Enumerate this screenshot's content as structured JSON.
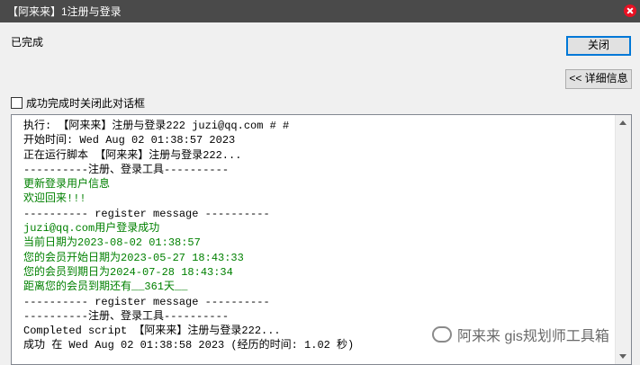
{
  "window": {
    "title": "【阿来来】1注册与登录"
  },
  "status_text": "已完成",
  "buttons": {
    "close": "关闭",
    "details": "<< 详细信息"
  },
  "checkbox": {
    "label": "成功完成时关闭此对话框"
  },
  "log_lines": [
    {
      "text": "执行: 【阿来来】注册与登录222 juzi@qq.com # #",
      "color": "black"
    },
    {
      "text": "开始时间: Wed Aug 02 01:38:57 2023",
      "color": "black"
    },
    {
      "text": "正在运行脚本 【阿来来】注册与登录222...",
      "color": "black"
    },
    {
      "text": "----------注册、登录工具----------",
      "color": "black"
    },
    {
      "text": "更新登录用户信息",
      "color": "green"
    },
    {
      "text": "欢迎回来!!!",
      "color": "green"
    },
    {
      "text": "---------- register message ----------",
      "color": "black"
    },
    {
      "text": "juzi@qq.com用户登录成功",
      "color": "green"
    },
    {
      "text": "当前日期为2023-08-02 01:38:57",
      "color": "green"
    },
    {
      "text": "您的会员开始日期为2023-05-27 18:43:33",
      "color": "green"
    },
    {
      "text": "您的会员到期日为2024-07-28 18:43:34",
      "color": "green"
    },
    {
      "text": "距离您的会员到期还有__361天__",
      "color": "green"
    },
    {
      "text": "---------- register message ----------",
      "color": "black"
    },
    {
      "text": "----------注册、登录工具----------",
      "color": "black"
    },
    {
      "text": "Completed script 【阿来来】注册与登录222...",
      "color": "black"
    },
    {
      "text": "成功 在 Wed Aug 02 01:38:58 2023 (经历的时间: 1.02 秒)",
      "color": "black"
    }
  ],
  "watermark": {
    "text": "阿来来 gis规划师工具箱"
  },
  "icons": {
    "close": "close-icon",
    "scroll_up": "chevron-up-icon",
    "scroll_down": "chevron-down-icon",
    "wechat": "wechat-icon"
  }
}
